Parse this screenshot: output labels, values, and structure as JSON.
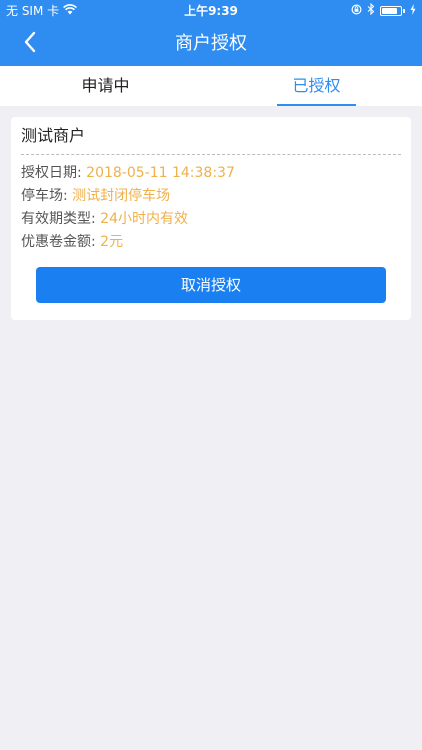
{
  "status_bar": {
    "carrier": "无 SIM 卡",
    "time": "上午9:39",
    "battery_level": 0.85
  },
  "nav": {
    "title": "商户授权"
  },
  "tabs": [
    {
      "label": "申请中",
      "active": false
    },
    {
      "label": "已授权",
      "active": true
    }
  ],
  "card": {
    "merchant_name": "测试商户",
    "rows": [
      {
        "label": "授权日期:",
        "value": "2018-05-11 14:38:37"
      },
      {
        "label": "停车场:",
        "value": "测试封闭停车场"
      },
      {
        "label": "有效期类型:",
        "value": "24小时内有效"
      },
      {
        "label": "优惠卷金额:",
        "value": "2元"
      }
    ],
    "cancel_label": "取消授权"
  },
  "colors": {
    "primary": "#2f8cf0",
    "button": "#1a7ff0",
    "value_text": "#f0b04a",
    "background": "#efeff4"
  }
}
